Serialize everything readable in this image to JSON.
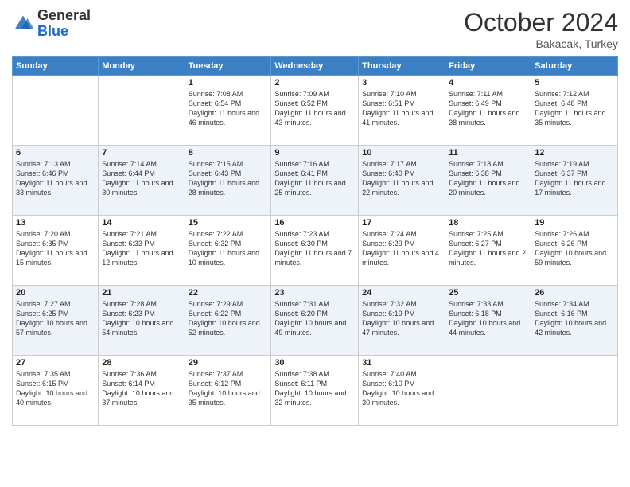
{
  "header": {
    "logo": {
      "general": "General",
      "blue": "Blue"
    },
    "title": "October 2024",
    "location": "Bakacak, Turkey"
  },
  "weekdays": [
    "Sunday",
    "Monday",
    "Tuesday",
    "Wednesday",
    "Thursday",
    "Friday",
    "Saturday"
  ],
  "weeks": [
    [
      {
        "day": "",
        "sunrise": "",
        "sunset": "",
        "daylight": ""
      },
      {
        "day": "",
        "sunrise": "",
        "sunset": "",
        "daylight": ""
      },
      {
        "day": "1",
        "sunrise": "Sunrise: 7:08 AM",
        "sunset": "Sunset: 6:54 PM",
        "daylight": "Daylight: 11 hours and 46 minutes."
      },
      {
        "day": "2",
        "sunrise": "Sunrise: 7:09 AM",
        "sunset": "Sunset: 6:52 PM",
        "daylight": "Daylight: 11 hours and 43 minutes."
      },
      {
        "day": "3",
        "sunrise": "Sunrise: 7:10 AM",
        "sunset": "Sunset: 6:51 PM",
        "daylight": "Daylight: 11 hours and 41 minutes."
      },
      {
        "day": "4",
        "sunrise": "Sunrise: 7:11 AM",
        "sunset": "Sunset: 6:49 PM",
        "daylight": "Daylight: 11 hours and 38 minutes."
      },
      {
        "day": "5",
        "sunrise": "Sunrise: 7:12 AM",
        "sunset": "Sunset: 6:48 PM",
        "daylight": "Daylight: 11 hours and 35 minutes."
      }
    ],
    [
      {
        "day": "6",
        "sunrise": "Sunrise: 7:13 AM",
        "sunset": "Sunset: 6:46 PM",
        "daylight": "Daylight: 11 hours and 33 minutes."
      },
      {
        "day": "7",
        "sunrise": "Sunrise: 7:14 AM",
        "sunset": "Sunset: 6:44 PM",
        "daylight": "Daylight: 11 hours and 30 minutes."
      },
      {
        "day": "8",
        "sunrise": "Sunrise: 7:15 AM",
        "sunset": "Sunset: 6:43 PM",
        "daylight": "Daylight: 11 hours and 28 minutes."
      },
      {
        "day": "9",
        "sunrise": "Sunrise: 7:16 AM",
        "sunset": "Sunset: 6:41 PM",
        "daylight": "Daylight: 11 hours and 25 minutes."
      },
      {
        "day": "10",
        "sunrise": "Sunrise: 7:17 AM",
        "sunset": "Sunset: 6:40 PM",
        "daylight": "Daylight: 11 hours and 22 minutes."
      },
      {
        "day": "11",
        "sunrise": "Sunrise: 7:18 AM",
        "sunset": "Sunset: 6:38 PM",
        "daylight": "Daylight: 11 hours and 20 minutes."
      },
      {
        "day": "12",
        "sunrise": "Sunrise: 7:19 AM",
        "sunset": "Sunset: 6:37 PM",
        "daylight": "Daylight: 11 hours and 17 minutes."
      }
    ],
    [
      {
        "day": "13",
        "sunrise": "Sunrise: 7:20 AM",
        "sunset": "Sunset: 6:35 PM",
        "daylight": "Daylight: 11 hours and 15 minutes."
      },
      {
        "day": "14",
        "sunrise": "Sunrise: 7:21 AM",
        "sunset": "Sunset: 6:33 PM",
        "daylight": "Daylight: 11 hours and 12 minutes."
      },
      {
        "day": "15",
        "sunrise": "Sunrise: 7:22 AM",
        "sunset": "Sunset: 6:32 PM",
        "daylight": "Daylight: 11 hours and 10 minutes."
      },
      {
        "day": "16",
        "sunrise": "Sunrise: 7:23 AM",
        "sunset": "Sunset: 6:30 PM",
        "daylight": "Daylight: 11 hours and 7 minutes."
      },
      {
        "day": "17",
        "sunrise": "Sunrise: 7:24 AM",
        "sunset": "Sunset: 6:29 PM",
        "daylight": "Daylight: 11 hours and 4 minutes."
      },
      {
        "day": "18",
        "sunrise": "Sunrise: 7:25 AM",
        "sunset": "Sunset: 6:27 PM",
        "daylight": "Daylight: 11 hours and 2 minutes."
      },
      {
        "day": "19",
        "sunrise": "Sunrise: 7:26 AM",
        "sunset": "Sunset: 6:26 PM",
        "daylight": "Daylight: 10 hours and 59 minutes."
      }
    ],
    [
      {
        "day": "20",
        "sunrise": "Sunrise: 7:27 AM",
        "sunset": "Sunset: 6:25 PM",
        "daylight": "Daylight: 10 hours and 57 minutes."
      },
      {
        "day": "21",
        "sunrise": "Sunrise: 7:28 AM",
        "sunset": "Sunset: 6:23 PM",
        "daylight": "Daylight: 10 hours and 54 minutes."
      },
      {
        "day": "22",
        "sunrise": "Sunrise: 7:29 AM",
        "sunset": "Sunset: 6:22 PM",
        "daylight": "Daylight: 10 hours and 52 minutes."
      },
      {
        "day": "23",
        "sunrise": "Sunrise: 7:31 AM",
        "sunset": "Sunset: 6:20 PM",
        "daylight": "Daylight: 10 hours and 49 minutes."
      },
      {
        "day": "24",
        "sunrise": "Sunrise: 7:32 AM",
        "sunset": "Sunset: 6:19 PM",
        "daylight": "Daylight: 10 hours and 47 minutes."
      },
      {
        "day": "25",
        "sunrise": "Sunrise: 7:33 AM",
        "sunset": "Sunset: 6:18 PM",
        "daylight": "Daylight: 10 hours and 44 minutes."
      },
      {
        "day": "26",
        "sunrise": "Sunrise: 7:34 AM",
        "sunset": "Sunset: 6:16 PM",
        "daylight": "Daylight: 10 hours and 42 minutes."
      }
    ],
    [
      {
        "day": "27",
        "sunrise": "Sunrise: 7:35 AM",
        "sunset": "Sunset: 6:15 PM",
        "daylight": "Daylight: 10 hours and 40 minutes."
      },
      {
        "day": "28",
        "sunrise": "Sunrise: 7:36 AM",
        "sunset": "Sunset: 6:14 PM",
        "daylight": "Daylight: 10 hours and 37 minutes."
      },
      {
        "day": "29",
        "sunrise": "Sunrise: 7:37 AM",
        "sunset": "Sunset: 6:12 PM",
        "daylight": "Daylight: 10 hours and 35 minutes."
      },
      {
        "day": "30",
        "sunrise": "Sunrise: 7:38 AM",
        "sunset": "Sunset: 6:11 PM",
        "daylight": "Daylight: 10 hours and 32 minutes."
      },
      {
        "day": "31",
        "sunrise": "Sunrise: 7:40 AM",
        "sunset": "Sunset: 6:10 PM",
        "daylight": "Daylight: 10 hours and 30 minutes."
      },
      {
        "day": "",
        "sunrise": "",
        "sunset": "",
        "daylight": ""
      },
      {
        "day": "",
        "sunrise": "",
        "sunset": "",
        "daylight": ""
      }
    ]
  ]
}
